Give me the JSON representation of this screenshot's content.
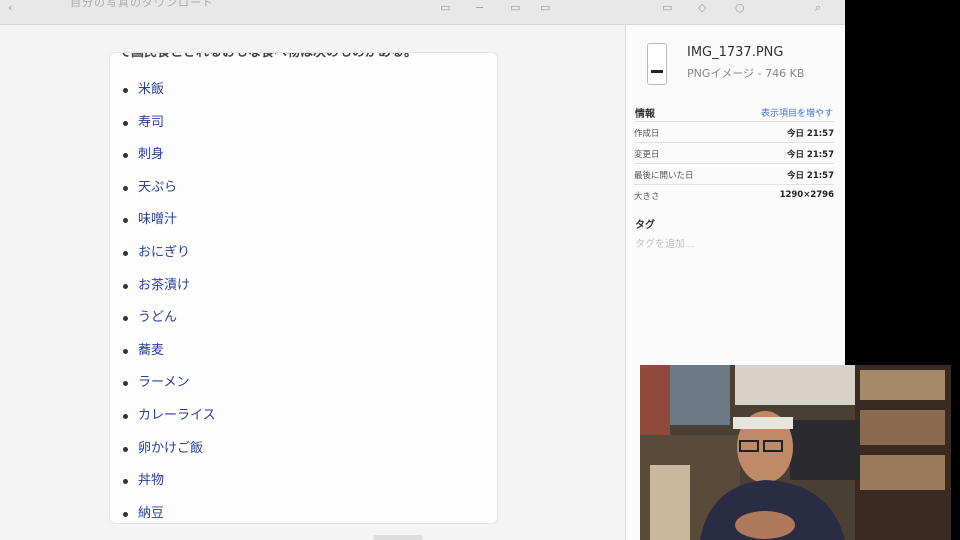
{
  "toolbar": {
    "title": "自分の写真のダウンロード"
  },
  "document": {
    "intro_text": "で国民食とされるおもな食べ物は次のものがある。",
    "foods": [
      "米飯",
      "寿司",
      "刺身",
      "天ぷら",
      "味噌汁",
      "おにぎり",
      "お茶漬け",
      "うどん",
      "蕎麦",
      "ラーメン",
      "カレーライス",
      "卵かけご飯",
      "丼物",
      "納豆"
    ]
  },
  "info_panel": {
    "file_name": "IMG_1737.PNG",
    "file_meta": "PNGイメージ - 746 KB",
    "info_title": "情報",
    "show_more": "表示項目を増やす",
    "rows": [
      {
        "key": "作成日",
        "value": "今日 21:57"
      },
      {
        "key": "変更日",
        "value": "今日 21:57"
      },
      {
        "key": "最後に開いた日",
        "value": "今日 21:57"
      },
      {
        "key": "大きさ",
        "value": "1290×2796"
      }
    ],
    "tags_title": "タグ",
    "tags_placeholder": "タグを追加..."
  },
  "colors": {
    "link_blue": "#2a3f9a",
    "accent_blue": "#3a6ee8"
  }
}
